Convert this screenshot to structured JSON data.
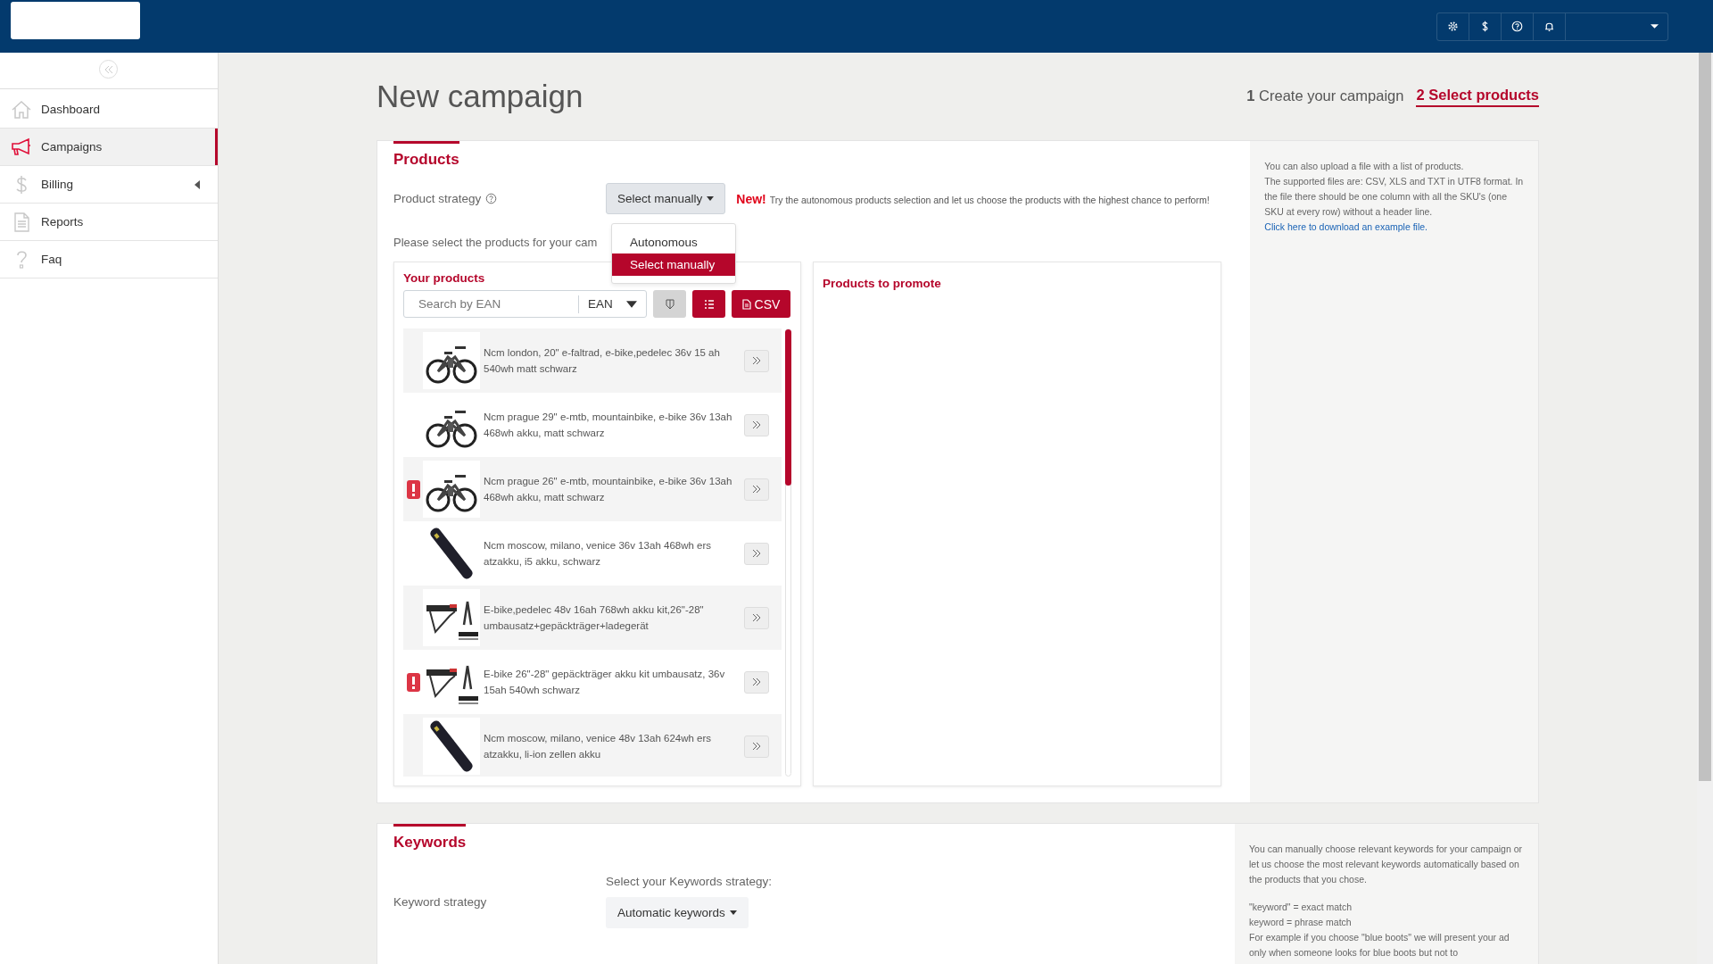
{
  "sidebar": {
    "items": [
      {
        "label": "Dashboard",
        "kind": "link",
        "selected": false
      },
      {
        "label": "Campaigns",
        "kind": "link",
        "selected": true
      },
      {
        "label": "Billing",
        "kind": "group",
        "selected": false
      },
      {
        "label": "Reports",
        "kind": "link",
        "selected": false
      },
      {
        "label": "Faq",
        "kind": "link",
        "selected": false
      }
    ]
  },
  "page": {
    "title": "New campaign",
    "steps": [
      {
        "number": "1",
        "label": "Create your campaign",
        "selected": false
      },
      {
        "number": "2",
        "label": "Select products",
        "selected": true
      }
    ]
  },
  "products": {
    "heading": "Products",
    "strategy_label": "Product strategy",
    "strategy_value": "Select manually",
    "menu": [
      {
        "label": "Autonomous",
        "selected": false
      },
      {
        "label": "Select manually",
        "selected": true
      }
    ],
    "new_badge": "New!",
    "new_text": "Try the autonomous products selection and let us choose the products with the highest chance to perform!",
    "instruction": "Please select the products for your cam",
    "your_products": {
      "heading": "Your products",
      "search_placeholder": "Search by EAN",
      "search_type": "EAN",
      "csv_label": "CSV",
      "items": [
        {
          "name": "Ncm london, 20\" e-faltrad, e-bike,pedelec 36v 15 ah 540wh matt schwarz",
          "warning": false
        },
        {
          "name": "Ncm prague 29\" e-mtb, mountainbike, e-bike 36v 13ah 468wh akku, matt schwarz",
          "warning": false
        },
        {
          "name": "Ncm prague 26\" e-mtb, mountainbike, e-bike 36v 13ah 468wh akku, matt schwarz",
          "warning": true
        },
        {
          "name": "Ncm moscow, milano, venice 36v 13ah 468wh ers atzakku, i5 akku, schwarz",
          "warning": false
        },
        {
          "name": "E-bike,pedelec 48v 16ah 768wh akku kit,26\"-28\" umbausatz+gepäckträger+ladegerät",
          "warning": false
        },
        {
          "name": "E-bike 26\"-28\" gepäckträger akku kit umbausatz, 36v 15ah 540wh schwarz",
          "warning": true
        },
        {
          "name": "Ncm moscow, milano, venice 48v 13ah 624wh ers atzakku, li-ion zellen akku",
          "warning": false
        }
      ]
    },
    "promote": {
      "heading": "Products to promote"
    },
    "help": {
      "lines": [
        "You can also upload a file with a list of products.",
        "The supported files are: CSV, XLS and TXT in UTF8 format. In the file there should be one column with all the SKU's (one SKU at every row) without a header line."
      ],
      "link": "Click here to download an example file."
    }
  },
  "keywords": {
    "heading": "Keywords",
    "strategy_label": "Keyword strategy",
    "select_label": "Select your Keywords strategy:",
    "strategy_value": "Automatic keywords",
    "help": [
      "You can manually choose relevant keywords for your campaign or let us choose the most relevant keywords automatically based on the products that you chose.",
      "\"keyword\" = exact match",
      "keyword = phrase match",
      "For example if you choose \"blue boots\" we will present your ad only when someone looks for blue boots but not to"
    ]
  }
}
